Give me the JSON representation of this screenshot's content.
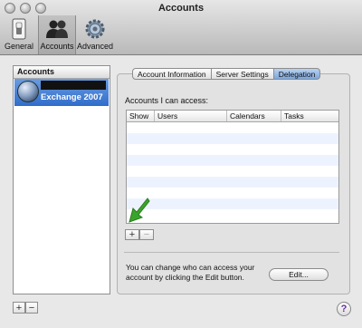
{
  "window": {
    "title": "Accounts"
  },
  "toolbar": {
    "items": [
      {
        "label": "General",
        "icon": "switch-icon"
      },
      {
        "label": "Accounts",
        "icon": "people-icon",
        "selected": true
      },
      {
        "label": "Advanced",
        "icon": "gear-icon"
      }
    ]
  },
  "sidebar": {
    "header": "Accounts",
    "accounts": [
      {
        "name": "",
        "type": "Exchange 2007",
        "selected": true,
        "icon": "globe-icon"
      }
    ],
    "add_label": "+",
    "remove_label": "−"
  },
  "tabs": [
    {
      "label": "Account Information",
      "selected": false
    },
    {
      "label": "Server Settings",
      "selected": false
    },
    {
      "label": "Delegation",
      "selected": true
    }
  ],
  "delegation": {
    "access_label": "Accounts I can access:",
    "columns": [
      "Show",
      "Users",
      "Calendars",
      "Tasks"
    ],
    "rows": [],
    "add_label": "+",
    "remove_label": "−",
    "note": "You can change who can access your account by clicking the Edit button.",
    "edit_label": "Edit..."
  },
  "help_label": "?",
  "colors": {
    "selection": "#3d78d4",
    "tab_selected": "#8fb4e2",
    "arrow": "#3aa52b",
    "help": "#6a2fa0"
  }
}
